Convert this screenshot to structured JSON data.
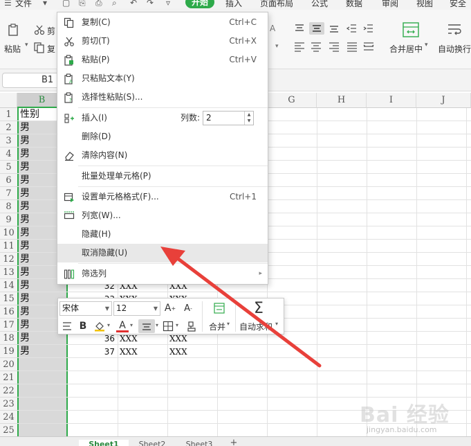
{
  "menubar": {
    "file": "文件",
    "start": "开始",
    "insert": "插入",
    "page_layout": "页面布局",
    "formula": "公式",
    "data": "数据",
    "review": "审阅",
    "view": "视图",
    "security": "安全"
  },
  "ribbon": {
    "paste": "粘贴",
    "cut_partial": "剪",
    "copy_partial": "复",
    "merge_center": "合并居中",
    "auto_wrap": "自动换行"
  },
  "formula_bar": {
    "cell_ref": "B1"
  },
  "grid": {
    "columns": [
      "B",
      "G",
      "H",
      "I",
      "J"
    ],
    "rows": [
      "1",
      "2",
      "3",
      "4",
      "5",
      "6",
      "7",
      "8",
      "9",
      "10",
      "11",
      "12",
      "13",
      "14",
      "15",
      "16",
      "17",
      "18",
      "19",
      "20",
      "21",
      "22",
      "23",
      "24",
      "25"
    ],
    "col_b_values": [
      "性别",
      "男",
      "男",
      "男",
      "男",
      "男",
      "男",
      "男",
      "男",
      "男",
      "男",
      "男",
      "男",
      "男",
      "男",
      "男",
      "男",
      "男",
      "男"
    ],
    "visible_rows": [
      {
        "row": "14",
        "num": "32",
        "c1": "XXX",
        "c2": "XXX"
      },
      {
        "row": "15",
        "num": "33",
        "c1": "XXX",
        "c2": "XXX"
      },
      {
        "row": "18",
        "num": "36",
        "c1": "XXX",
        "c2": "XXX"
      },
      {
        "row": "19",
        "num": "37",
        "c1": "XXX",
        "c2": "XXX"
      }
    ]
  },
  "context_menu": {
    "items": [
      {
        "label": "复制(C)",
        "shortcut": "Ctrl+C",
        "icon": "copy-icon"
      },
      {
        "label": "剪切(T)",
        "shortcut": "Ctrl+X",
        "icon": "scissors-icon"
      },
      {
        "label": "粘贴(P)",
        "shortcut": "Ctrl+V",
        "icon": "paste-icon"
      },
      {
        "label": "只粘贴文本(Y)",
        "shortcut": "",
        "icon": "paste-text-icon"
      },
      {
        "label": "选择性粘贴(S)...",
        "shortcut": "",
        "icon": "paste-special-icon"
      },
      {
        "label": "插入(I)",
        "shortcut": "",
        "icon": "insert-column-icon"
      },
      {
        "label": "删除(D)",
        "shortcut": "",
        "icon": ""
      },
      {
        "label": "清除内容(N)",
        "shortcut": "",
        "icon": "eraser-icon"
      },
      {
        "label": "批量处理单元格(P)",
        "shortcut": "",
        "icon": ""
      },
      {
        "label": "设置单元格格式(F)...",
        "shortcut": "Ctrl+1",
        "icon": "format-cells-icon"
      },
      {
        "label": "列宽(W)...",
        "shortcut": "",
        "icon": "column-width-icon"
      },
      {
        "label": "隐藏(H)",
        "shortcut": "",
        "icon": ""
      },
      {
        "label": "取消隐藏(U)",
        "shortcut": "",
        "icon": ""
      },
      {
        "label": "筛选列",
        "shortcut": "",
        "icon": "filter-column-icon"
      }
    ],
    "col_count_label": "列数:",
    "col_count_value": "2"
  },
  "mini_toolbar": {
    "font_name": "宋体",
    "font_size": "12",
    "merge": "合并",
    "auto_sum": "自动求和"
  },
  "sheets": [
    "Sheet1",
    "Sheet2",
    "Sheet3"
  ],
  "watermark": {
    "logo": "Bai 经验",
    "url": "jingyan.baidu.com"
  },
  "colors": {
    "accent": "#2eaa4a",
    "arrow": "#e8403a"
  }
}
